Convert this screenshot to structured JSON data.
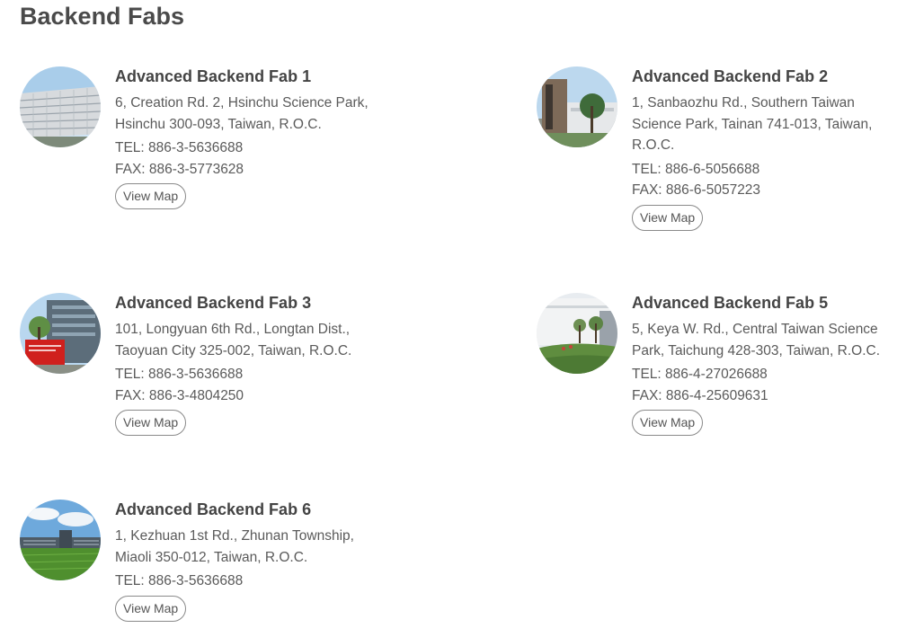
{
  "page": {
    "title": "Backend Fabs"
  },
  "fabs": [
    {
      "name": "Advanced Backend Fab 1",
      "address": "6, Creation Rd. 2, Hsinchu Science Park, Hsinchu 300-093, Taiwan, R.O.C.",
      "tel": "TEL: 886-3-5636688",
      "fax": "FAX: 886-3-5773628",
      "map_label": "View Map"
    },
    {
      "name": "Advanced Backend Fab 2",
      "address": "1, Sanbaozhu Rd., Southern Taiwan Science Park, Tainan 741-013, Taiwan, R.O.C.",
      "tel": "TEL: 886-6-5056688",
      "fax": "FAX: 886-6-5057223",
      "map_label": "View Map"
    },
    {
      "name": "Advanced Backend Fab 3",
      "address": "101, Longyuan 6th Rd., Longtan Dist., Taoyuan City 325-002, Taiwan, R.O.C.",
      "tel": "TEL: 886-3-5636688",
      "fax": "FAX: 886-3-4804250",
      "map_label": "View Map"
    },
    {
      "name": "Advanced Backend Fab 5",
      "address": "5, Keya W. Rd., Central Taiwan Science Park, Taichung 428-303, Taiwan, R.O.C.",
      "tel": "TEL: 886-4-27026688",
      "fax": "FAX: 886-4-25609631",
      "map_label": "View Map"
    },
    {
      "name": "Advanced Backend Fab 6",
      "address": "1, Kezhuan 1st Rd., Zhunan Township, Miaoli 350-012, Taiwan, R.O.C.",
      "tel": "TEL: 886-3-5636688",
      "map_label": "View Map"
    }
  ]
}
